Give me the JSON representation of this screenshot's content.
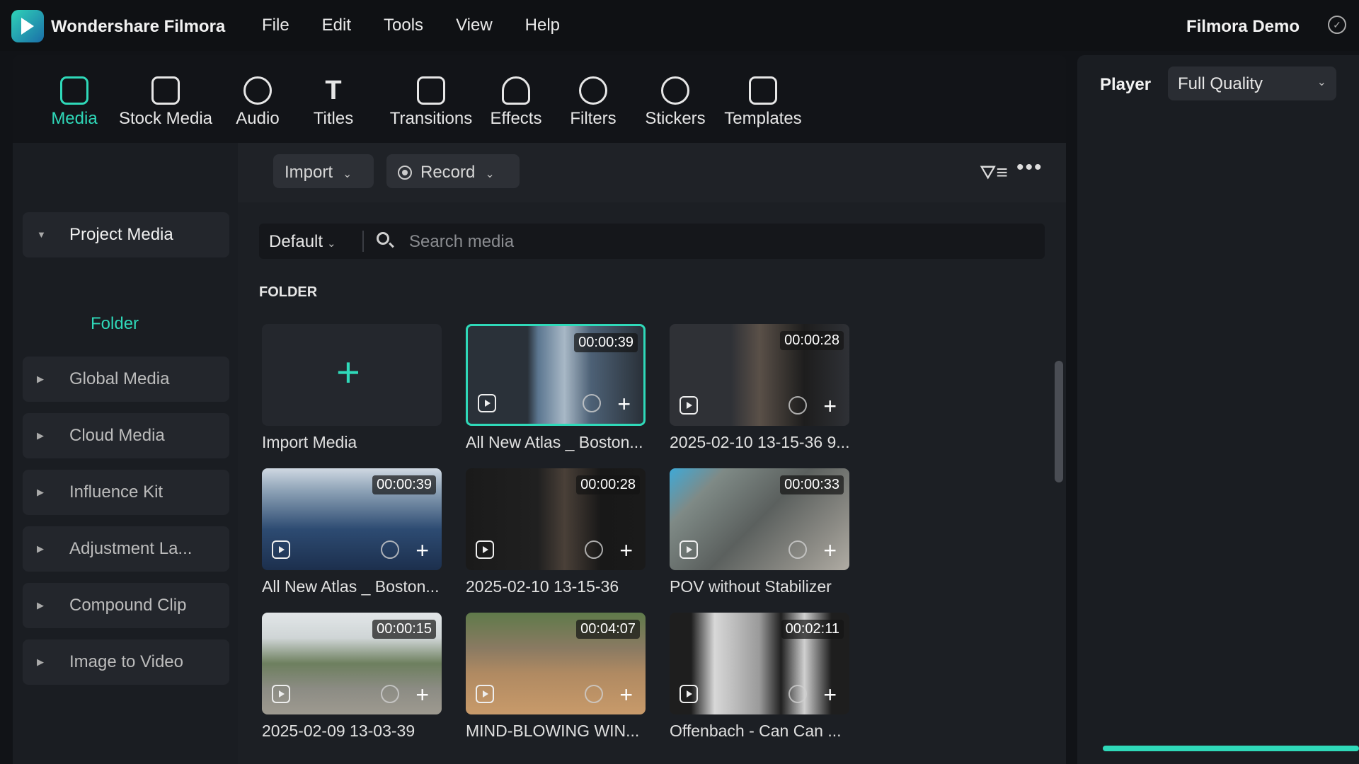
{
  "app": {
    "title": "Wondershare Filmora",
    "project": "Filmora Demo"
  },
  "menu": [
    "File",
    "Edit",
    "Tools",
    "View",
    "Help"
  ],
  "toolbar": [
    {
      "label": "Media",
      "icon": "media-icon",
      "active": true
    },
    {
      "label": "Stock Media",
      "icon": "stock-media-icon"
    },
    {
      "label": "Audio",
      "icon": "audio-icon"
    },
    {
      "label": "Titles",
      "icon": "titles-icon"
    },
    {
      "label": "Transitions",
      "icon": "transitions-icon"
    },
    {
      "label": "Effects",
      "icon": "effects-icon"
    },
    {
      "label": "Filters",
      "icon": "filters-icon"
    },
    {
      "label": "Stickers",
      "icon": "stickers-icon"
    },
    {
      "label": "Templates",
      "icon": "templates-icon"
    }
  ],
  "sidebar": {
    "items": [
      {
        "label": "Project Media",
        "open": true
      },
      {
        "label": "Global Media"
      },
      {
        "label": "Cloud Media"
      },
      {
        "label": "Influence Kit"
      },
      {
        "label": "Adjustment La..."
      },
      {
        "label": "Compound Clip"
      },
      {
        "label": "Image to Video"
      }
    ],
    "folder": "Folder"
  },
  "controls": {
    "import": "Import",
    "record": "Record"
  },
  "search": {
    "sort": "Default",
    "placeholder": "Search media"
  },
  "section": "FOLDER",
  "media": [
    {
      "name": "Import Media",
      "type": "import"
    },
    {
      "name": "All New Atlas _ Boston...",
      "duration": "00:00:39",
      "selected": true,
      "bg": "#3a4f63"
    },
    {
      "name": "2025-02-10 13-15-36 9...",
      "duration": "00:00:28",
      "bg": "#2b2b2b"
    },
    {
      "name": "All New Atlas _ Boston...",
      "duration": "00:00:39",
      "bg": "#3e5672"
    },
    {
      "name": "2025-02-10 13-15-36",
      "duration": "00:00:28",
      "bg": "#1e1e1e"
    },
    {
      "name": "POV without Stabilizer",
      "duration": "00:00:33",
      "bg": "#6b6f6c"
    },
    {
      "name": "2025-02-09 13-03-39",
      "duration": "00:00:15",
      "bg": "#7a8a72"
    },
    {
      "name": "MIND-BLOWING WIN...",
      "duration": "00:04:07",
      "bg": "#8a6e52"
    },
    {
      "name": "Offenbach - Can Can ...",
      "duration": "00:02:11",
      "bg": "#bdbdbd"
    }
  ],
  "player": {
    "label": "Player",
    "quality": "Full Quality"
  },
  "colors": {
    "accent": "#2fd9b9",
    "background": "#111317",
    "panel": "#1a1d22"
  }
}
